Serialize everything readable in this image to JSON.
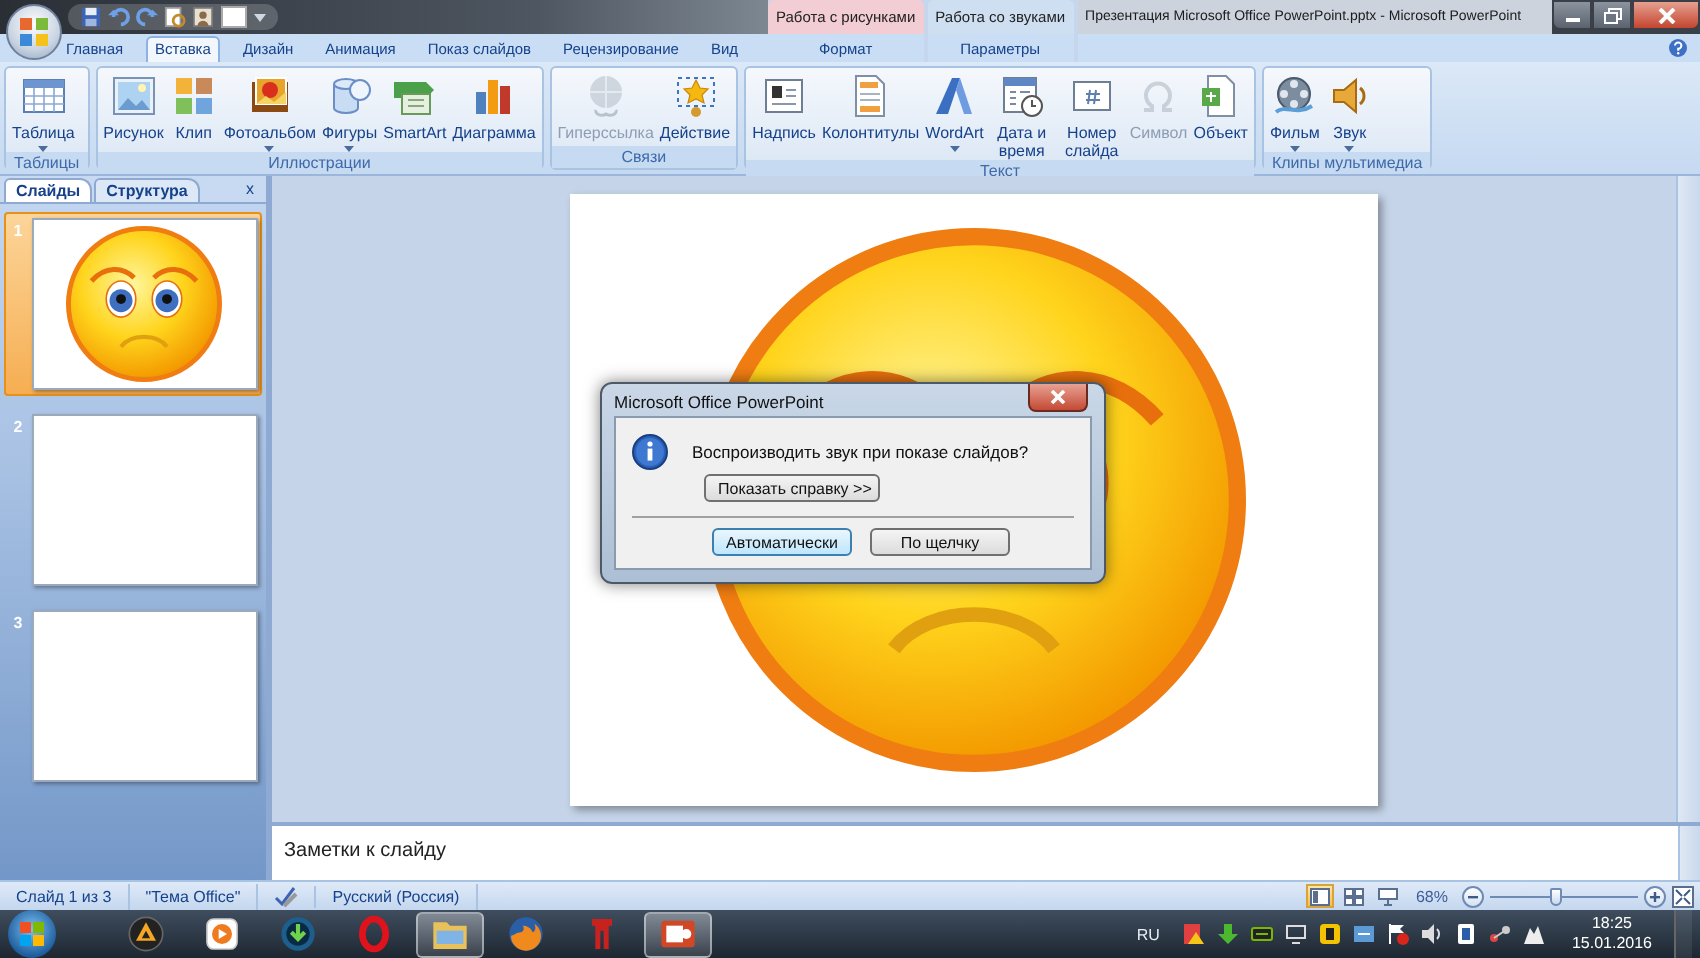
{
  "window": {
    "title": "Презентация Microsoft Office PowerPoint.pptx - Microsoft PowerPoint"
  },
  "ribbon_tabs": [
    {
      "label": "Главная",
      "selected": false
    },
    {
      "label": "Вставка",
      "selected": true
    },
    {
      "label": "Дизайн",
      "selected": false
    },
    {
      "label": "Анимация",
      "selected": false
    },
    {
      "label": "Показ слайдов",
      "selected": false
    },
    {
      "label": "Рецензирование",
      "selected": false
    },
    {
      "label": "Вид",
      "selected": false
    }
  ],
  "contextual_groups": [
    {
      "title": "Работа с рисунками",
      "color": "#f2cdd3",
      "tab": {
        "label": "Формат",
        "selected": false
      }
    },
    {
      "title": "Работа со звуками",
      "color": "#cfdff2",
      "tab": {
        "label": "Параметры",
        "selected": false
      }
    }
  ],
  "ribbon_groups": [
    {
      "title": "Таблицы",
      "commands": [
        {
          "label": "Таблица",
          "dropdown": true,
          "disabled": false
        }
      ]
    },
    {
      "title": "Иллюстрации",
      "commands": [
        {
          "label": "Рисунок",
          "dropdown": false,
          "disabled": false
        },
        {
          "label": "Клип",
          "dropdown": false,
          "disabled": false
        },
        {
          "label": "Фотоальбом",
          "dropdown": true,
          "disabled": false
        },
        {
          "label": "Фигуры",
          "dropdown": true,
          "disabled": false
        },
        {
          "label": "SmartArt",
          "dropdown": false,
          "disabled": false
        },
        {
          "label": "Диаграмма",
          "dropdown": false,
          "disabled": false
        }
      ]
    },
    {
      "title": "Связи",
      "commands": [
        {
          "label": "Гиперссылка",
          "dropdown": false,
          "disabled": true
        },
        {
          "label": "Действие",
          "dropdown": false,
          "disabled": false
        }
      ]
    },
    {
      "title": "Текст",
      "commands": [
        {
          "label": "Надпись",
          "dropdown": false,
          "disabled": false
        },
        {
          "label": "Колонтитулы",
          "dropdown": false,
          "disabled": false
        },
        {
          "label": "WordArt",
          "dropdown": true,
          "disabled": false
        },
        {
          "label": "Дата и время",
          "dropdown": false,
          "disabled": false
        },
        {
          "label": "Номер слайда",
          "dropdown": false,
          "disabled": false
        },
        {
          "label": "Символ",
          "dropdown": false,
          "disabled": true
        },
        {
          "label": "Объект",
          "dropdown": false,
          "disabled": false
        }
      ]
    },
    {
      "title": "Клипы мультимедиа",
      "commands": [
        {
          "label": "Фильм",
          "dropdown": true,
          "disabled": false
        },
        {
          "label": "Звук",
          "dropdown": true,
          "disabled": false
        }
      ]
    }
  ],
  "slides_panel": {
    "tabs": [
      {
        "label": "Слайды",
        "selected": true
      },
      {
        "label": "Структура",
        "selected": false
      }
    ],
    "close": "x",
    "slides": [
      {
        "number": "1",
        "selected": true,
        "kind": "smiley"
      },
      {
        "number": "2",
        "selected": false,
        "kind": "blank"
      },
      {
        "number": "3",
        "selected": false,
        "kind": "blank"
      }
    ]
  },
  "dialog": {
    "title": "Microsoft Office PowerPoint",
    "message": "Воспроизводить звук при показе слайдов?",
    "details_button": "Показать справку >>",
    "buttons": [
      {
        "label": "Автоматически",
        "default": true
      },
      {
        "label": "По щелчку",
        "default": false
      }
    ]
  },
  "notes": {
    "placeholder": "Заметки к слайду"
  },
  "status_bar": {
    "slide": "Слайд 1 из 3",
    "theme": "\"Тема Office\"",
    "language": "Русский (Россия)",
    "views": [
      {
        "selected": true
      },
      {
        "selected": false
      },
      {
        "selected": false
      }
    ],
    "zoom": "68%",
    "zoom_slider": {
      "level": 0.45
    }
  },
  "taskbar": {
    "apps": [
      {
        "active": false
      },
      {
        "active": false
      },
      {
        "active": false
      },
      {
        "active": false
      },
      {
        "active": true
      },
      {
        "active": false
      },
      {
        "active": false
      },
      {
        "active": true
      }
    ],
    "language": "RU",
    "time": "18:25",
    "date": "15.01.2016"
  }
}
